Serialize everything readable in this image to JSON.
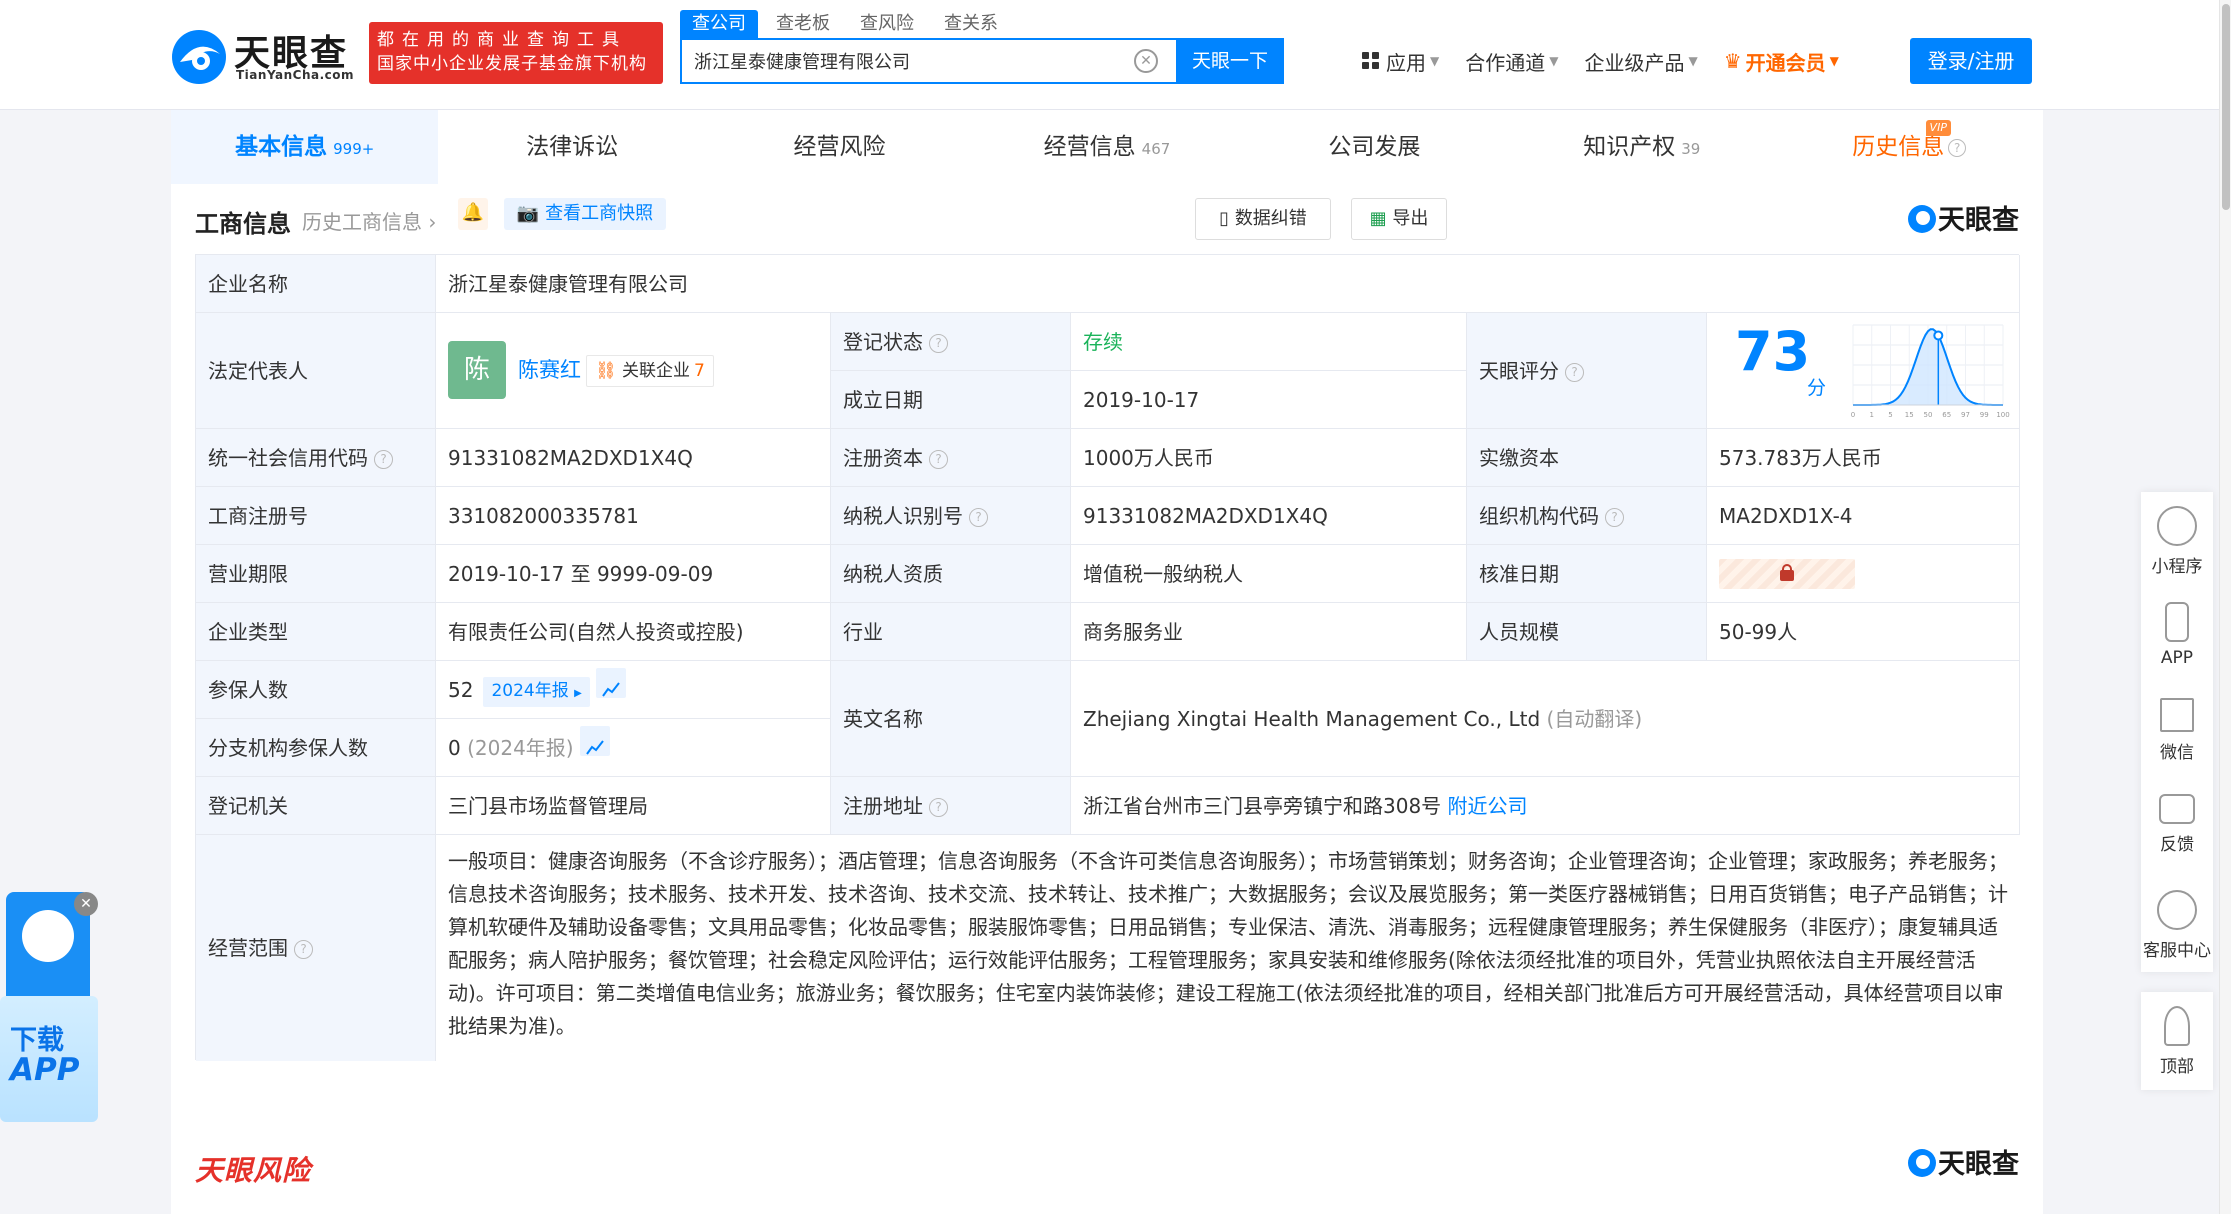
{
  "header": {
    "logo_cn": "天眼查",
    "logo_en": "TianYanCha.com",
    "slogan_line1": "都在用的商业查询工具",
    "slogan_line2": "国家中小企业发展子基金旗下机构",
    "search_tabs": [
      "查公司",
      "查老板",
      "查风险",
      "查关系"
    ],
    "search_value": "浙江星泰健康管理有限公司",
    "search_button": "天眼一下",
    "nav": {
      "apps": "应用",
      "partner": "合作通道",
      "enterprise": "企业级产品",
      "vip": "开通会员"
    },
    "login": "登录/注册"
  },
  "tabs": [
    {
      "label": "基本信息",
      "count": "999+"
    },
    {
      "label": "法律诉讼",
      "count": ""
    },
    {
      "label": "经营风险",
      "count": ""
    },
    {
      "label": "经营信息",
      "count": "467"
    },
    {
      "label": "公司发展",
      "count": ""
    },
    {
      "label": "知识产权",
      "count": "39"
    },
    {
      "label": "历史信息",
      "count": "",
      "tag": "VIP"
    }
  ],
  "section": {
    "title": "工商信息",
    "history_link": "历史工商信息",
    "snapshot": "查看工商快照",
    "correct": "数据纠错",
    "export": "导出",
    "brand": "天眼查"
  },
  "company": {
    "name_label": "企业名称",
    "name": "浙江星泰健康管理有限公司",
    "legal_label": "法定代表人",
    "legal_avatar": "陈",
    "legal_name": "陈赛红",
    "related_label": "关联企业",
    "related_count": "7",
    "status_label": "登记状态",
    "status": "存续",
    "founded_label": "成立日期",
    "founded": "2019-10-17",
    "score_label": "天眼评分",
    "score": "73",
    "score_unit": "分",
    "credit_label": "统一社会信用代码",
    "credit_code": "91331082MA2DXD1X4Q",
    "capital_label": "注册资本",
    "capital": "1000万人民币",
    "paid_label": "实缴资本",
    "paid": "573.783万人民币",
    "regno_label": "工商注册号",
    "regno": "331082000335781",
    "taxid_label": "纳税人识别号",
    "taxid": "91331082MA2DXD1X4Q",
    "orgcode_label": "组织机构代码",
    "orgcode": "MA2DXD1X-4",
    "term_label": "营业期限",
    "term": "2019-10-17 至 9999-09-09",
    "taxqual_label": "纳税人资质",
    "taxqual": "增值税一般纳税人",
    "approve_label": "核准日期",
    "type_label": "企业类型",
    "type": "有限责任公司(自然人投资或控股)",
    "industry_label": "行业",
    "industry": "商务服务业",
    "staff_label": "人员规模",
    "staff": "50-99人",
    "insured_label": "参保人数",
    "insured": "52",
    "insured_report": "2024年报",
    "branch_label": "分支机构参保人数",
    "branch": "0",
    "branch_note": "(2024年报)",
    "english_label": "英文名称",
    "english": "Zhejiang Xingtai Health Management Co., Ltd",
    "english_note": "(自动翻译)",
    "authority_label": "登记机关",
    "authority": "三门县市场监督管理局",
    "address_label": "注册地址",
    "address": "浙江省台州市三门县亭旁镇宁和路308号",
    "nearby": "附近公司",
    "scope_label": "经营范围",
    "scope": "一般项目：健康咨询服务（不含诊疗服务）；酒店管理；信息咨询服务（不含许可类信息咨询服务）；市场营销策划；财务咨询；企业管理咨询；企业管理；家政服务；养老服务；信息技术咨询服务；技术服务、技术开发、技术咨询、技术交流、技术转让、技术推广；大数据服务；会议及展览服务；第一类医疗器械销售；日用百货销售；电子产品销售；计算机软硬件及辅助设备零售；文具用品零售；化妆品零售；服装服饰零售；日用品销售；专业保洁、清洗、消毒服务；远程健康管理服务；养生保健服务（非医疗）；康复辅具适配服务；病人陪护服务；餐饮管理；社会稳定风险评估；运行效能评估服务；工程管理服务；家具安装和维修服务(除依法须经批准的项目外，凭营业执照依法自主开展经营活动)。许可项目：第二类增值电信业务；旅游业务；餐饮服务；住宅室内装饰装修；建设工程施工(依法须经批准的项目，经相关部门批准后方可开展经营活动，具体经营项目以审批结果为准)。"
  },
  "score_chart": {
    "x_ticks": [
      "0",
      "1",
      "5",
      "15",
      "50",
      "65",
      "97",
      "99",
      "100"
    ],
    "accent": "#0084ff"
  },
  "risk_title": "天眼风险",
  "right_float": [
    "小程序",
    "APP",
    "微信",
    "反馈",
    "客服中心",
    "顶部"
  ],
  "left_float": {
    "line1": "下载",
    "line2": "APP"
  },
  "colors": {
    "accent": "#0084ff",
    "brand_red": "#e5312a",
    "vip_orange": "#ff6600",
    "status_green": "#1bb35a"
  }
}
